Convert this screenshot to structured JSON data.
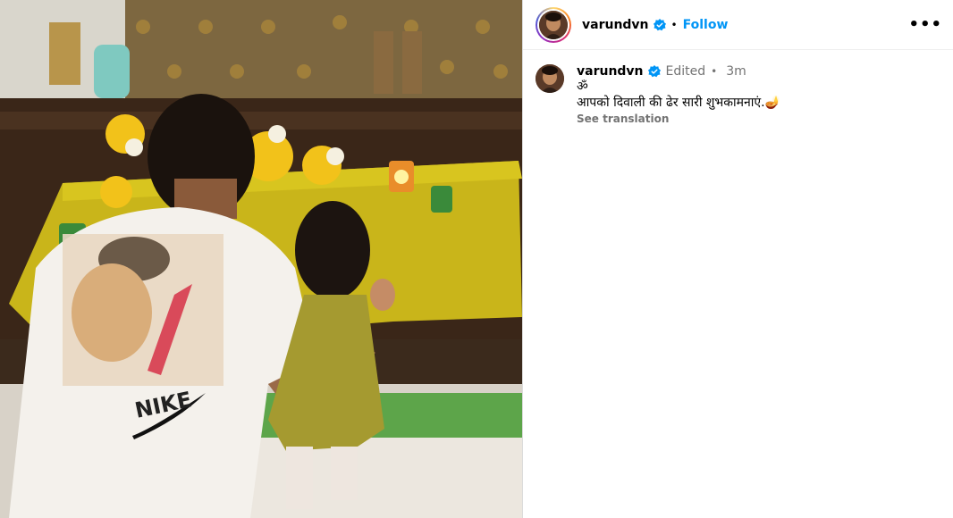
{
  "header": {
    "username": "varundvn",
    "separator": "•",
    "follow_label": "Follow",
    "more_label": "•••"
  },
  "caption": {
    "username": "varundvn",
    "edited_label": "Edited",
    "separator": "•",
    "timestamp": "3m",
    "om": "ॐ",
    "text": "आपको दिवाली की ढेर सारी शुभकामनाएं.",
    "emoji": "🪔",
    "see_translation": "See translation"
  },
  "icons": {
    "verified": "verified-badge-icon",
    "more": "more-options-icon"
  },
  "colors": {
    "accent": "#0095f6",
    "secondary_text": "#737373",
    "verified": "#0095f6"
  }
}
